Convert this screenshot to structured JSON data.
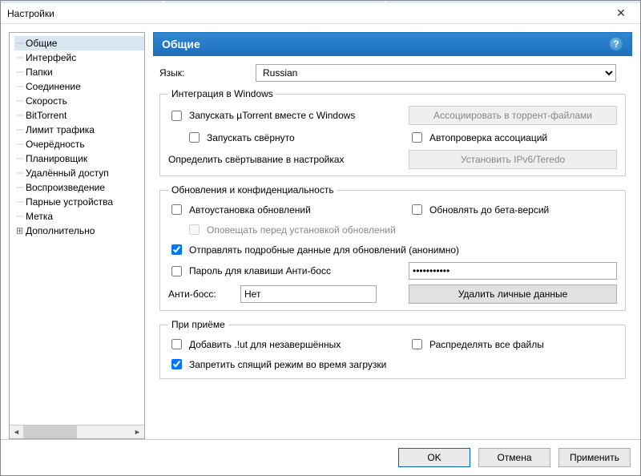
{
  "title": "Настройки",
  "tree": {
    "items": [
      {
        "label": "Общие"
      },
      {
        "label": "Интерфейс"
      },
      {
        "label": "Папки"
      },
      {
        "label": "Соединение"
      },
      {
        "label": "Скорость"
      },
      {
        "label": "BitTorrent"
      },
      {
        "label": "Лимит трафика"
      },
      {
        "label": "Очерёдность"
      },
      {
        "label": "Планировщик"
      },
      {
        "label": "Удалённый доступ"
      },
      {
        "label": "Воспроизведение"
      },
      {
        "label": "Парные устройства"
      },
      {
        "label": "Метка"
      },
      {
        "label": "Дополнительно"
      }
    ],
    "selected_index": 0,
    "expand_index": 13
  },
  "panel": {
    "title": "Общие",
    "language_label": "Язык:",
    "language_value": "Russian",
    "group_integration": {
      "legend": "Интеграция в Windows",
      "start_with_windows": "Запускать µTorrent вместе с Windows",
      "start_minimized": "Запускать свёрнуто",
      "associate_btn": "Ассоциировать в торрент-файлами",
      "autocheck_assoc": "Автопроверка ассоциаций",
      "minimize_hint": "Определить свёртывание в настройках",
      "install_ipv6_btn": "Установить IPv6/Teredo"
    },
    "group_updates": {
      "legend": "Обновления и конфиденциальность",
      "auto_install": "Автоустановка обновлений",
      "beta_versions": "Обновлять до бета-версий",
      "notify_before": "Оповещать перед установкой обновлений",
      "send_detailed": "Отправлять подробные данные для обновлений (анонимно)",
      "boss_password": "Пароль для клавиши Анти-босс",
      "boss_password_value": "•••••••••••",
      "anti_boss_label": "Анти-босс:",
      "anti_boss_value": "Нет",
      "delete_personal_btn": "Удалить личные данные"
    },
    "group_receive": {
      "legend": "При приёме",
      "add_ut": "Добавить .!ut для незавершённых",
      "preallocate": "Распределять все файлы",
      "no_sleep": "Запретить спящий режим во время загрузки"
    }
  },
  "footer": {
    "ok": "OK",
    "cancel": "Отмена",
    "apply": "Применить"
  },
  "checked": {
    "start_with_windows": false,
    "start_minimized": false,
    "autocheck_assoc": false,
    "auto_install": false,
    "beta_versions": false,
    "notify_before": false,
    "send_detailed": true,
    "boss_password": false,
    "add_ut": false,
    "preallocate": false,
    "no_sleep": true
  }
}
